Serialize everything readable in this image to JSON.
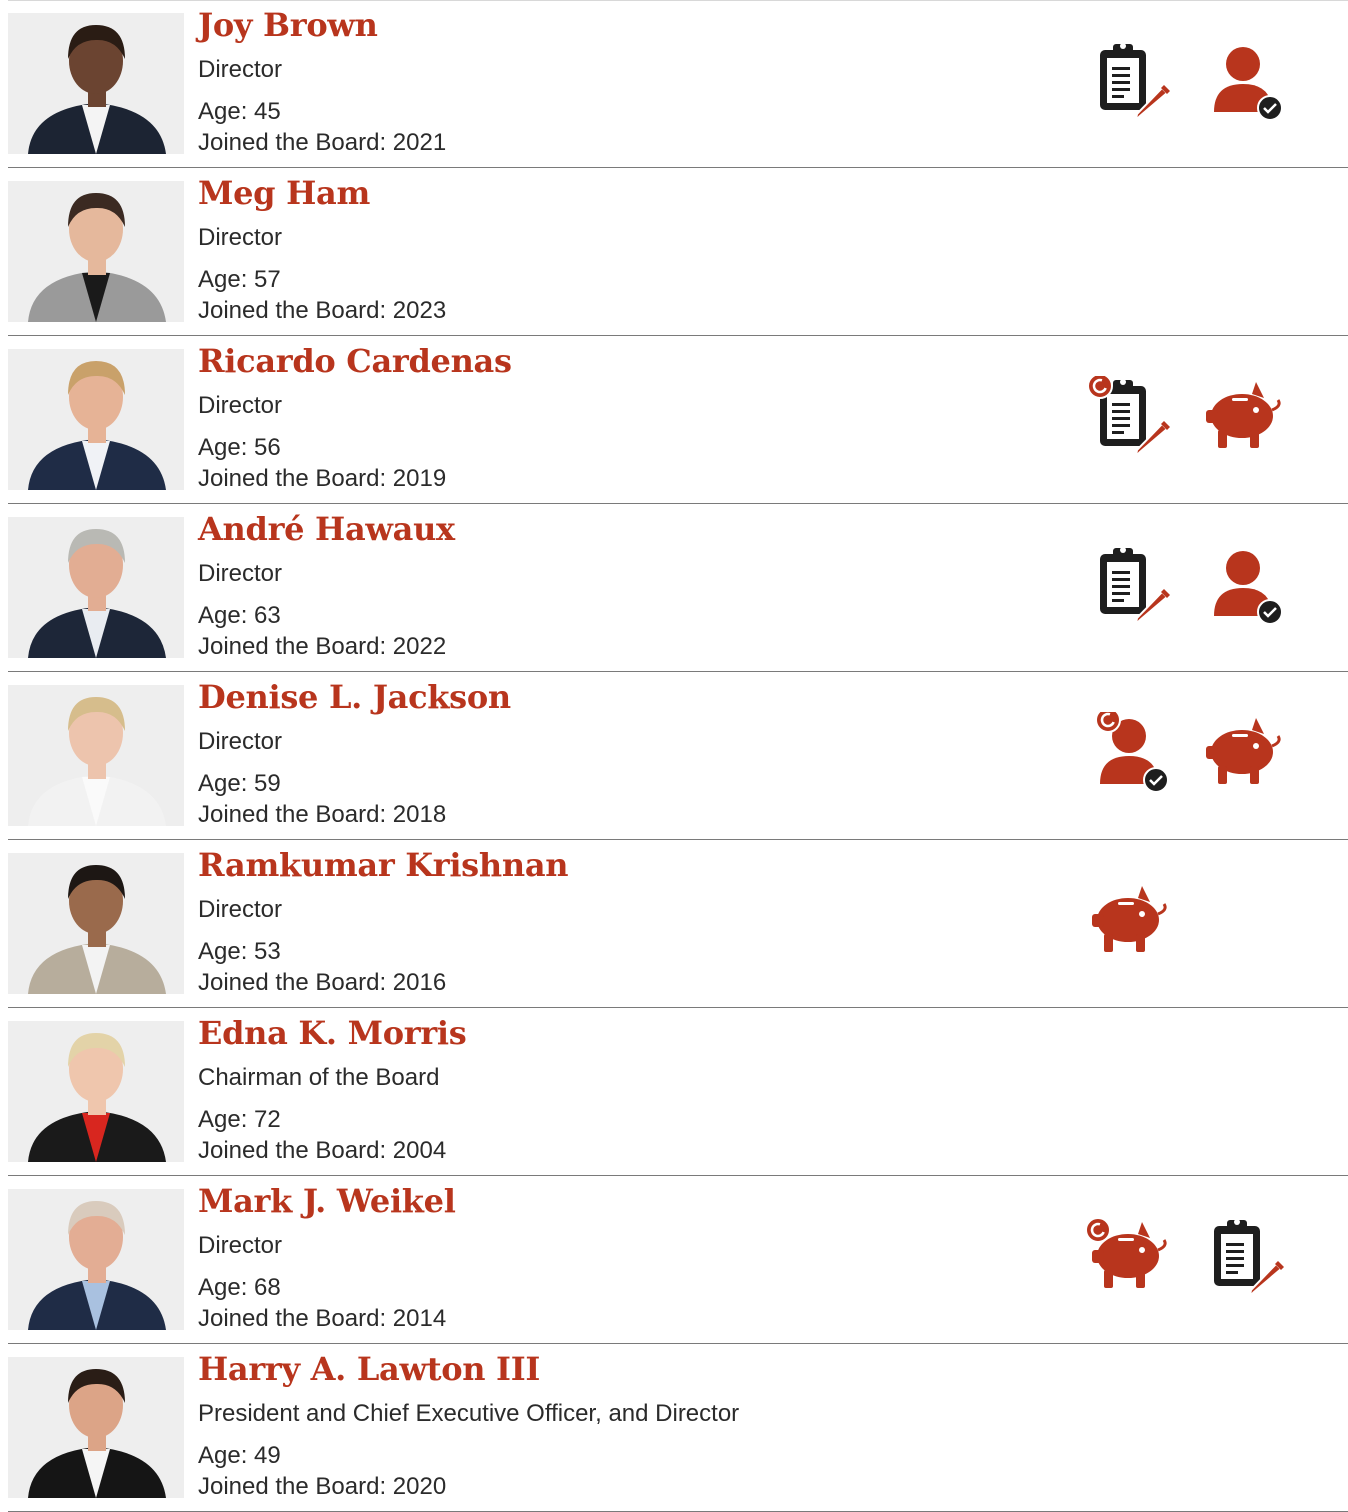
{
  "colors": {
    "accent": "#b8351d",
    "text": "#2b2b2b",
    "icon_dark": "#1e1e1e"
  },
  "joined_prefix": "Joined the Board: ",
  "age_prefix": "Age: ",
  "directors": [
    {
      "name": "Joy Brown",
      "title": "Director",
      "age": "45",
      "joined": "2021",
      "suit": "#1c2433",
      "shirt": "#f4f4f4",
      "skin": "#6b4431",
      "hair": "#2a1c14",
      "icons": [
        {
          "type": "clipboard-pencil-icon",
          "chair": false
        },
        {
          "type": "person-check-icon",
          "chair": false
        }
      ]
    },
    {
      "name": "Meg Ham",
      "title": "Director",
      "age": "57",
      "joined": "2023",
      "suit": "#9a9a9a",
      "shirt": "#1a1a1a",
      "skin": "#e5b89c",
      "hair": "#3b2a22",
      "icons": []
    },
    {
      "name": "Ricardo Cardenas",
      "title": "Director",
      "age": "56",
      "joined": "2019",
      "suit": "#1f2c46",
      "shirt": "#f0f2f6",
      "skin": "#e6b396",
      "hair": "#c9a16a",
      "icons": [
        {
          "type": "clipboard-pencil-icon",
          "chair": true
        },
        {
          "type": "piggy-bank-icon",
          "chair": false
        }
      ]
    },
    {
      "name": "André Hawaux",
      "title": "Director",
      "age": "63",
      "joined": "2022",
      "suit": "#1d2638",
      "shirt": "#e9ecf1",
      "skin": "#e2ad93",
      "hair": "#b9b9b4",
      "icons": [
        {
          "type": "clipboard-pencil-icon",
          "chair": false
        },
        {
          "type": "person-check-icon",
          "chair": false
        }
      ]
    },
    {
      "name": "Denise L. Jackson",
      "title": "Director",
      "age": "59",
      "joined": "2018",
      "suit": "#f2f2f2",
      "shirt": "#fafafa",
      "skin": "#edc4ad",
      "hair": "#d6bd8c",
      "icons": [
        {
          "type": "person-check-icon",
          "chair": true
        },
        {
          "type": "piggy-bank-icon",
          "chair": false
        }
      ]
    },
    {
      "name": "Ramkumar Krishnan",
      "title": "Director",
      "age": "53",
      "joined": "2016",
      "suit": "#b7ad9c",
      "shirt": "#f3f3f3",
      "skin": "#9a6a4c",
      "hair": "#1d1714",
      "icons": [
        {
          "type": "piggy-bank-icon",
          "chair": false
        }
      ]
    },
    {
      "name": "Edna K. Morris",
      "title": "Chairman of the Board",
      "age": "72",
      "joined": "2004",
      "suit": "#1a1a1a",
      "shirt": "#d8261f",
      "skin": "#efc6ad",
      "hair": "#e3d3a8",
      "icons": []
    },
    {
      "name": "Mark J. Weikel",
      "title": "Director",
      "age": "68",
      "joined": "2014",
      "suit": "#1f2c46",
      "shirt": "#a9c1e0",
      "skin": "#e3ad94",
      "hair": "#d9cbbd",
      "icons": [
        {
          "type": "piggy-bank-icon",
          "chair": true
        },
        {
          "type": "clipboard-pencil-icon",
          "chair": false
        }
      ]
    },
    {
      "name": "Harry A. Lawton III",
      "title": "President and Chief Executive Officer, and Director",
      "age": "49",
      "joined": "2020",
      "suit": "#151515",
      "shirt": "#f5f5f5",
      "skin": "#dca487",
      "hair": "#2a1d16",
      "icons": []
    }
  ]
}
